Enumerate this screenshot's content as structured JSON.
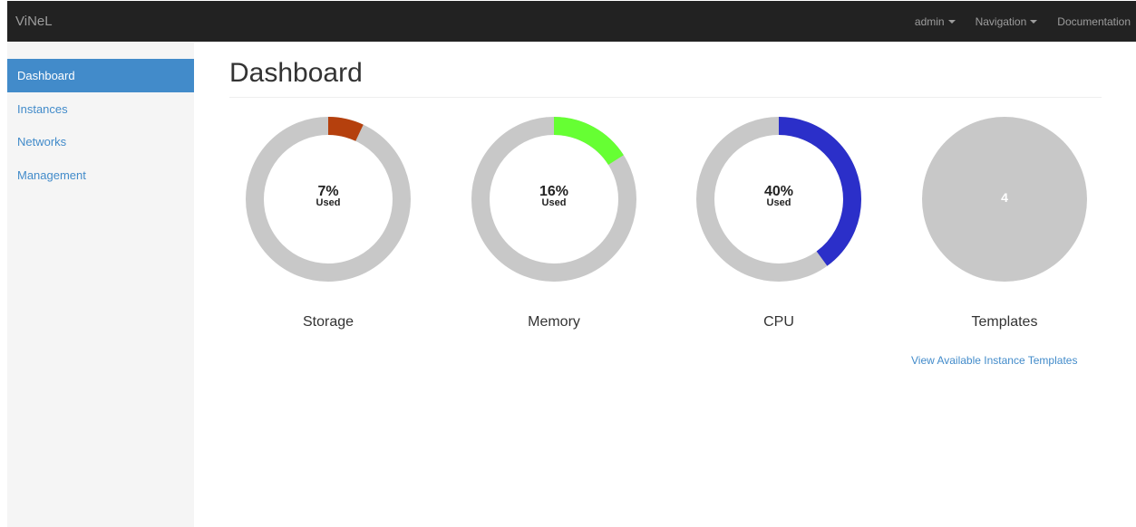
{
  "navbar": {
    "brand": "ViNeL",
    "user_menu": "admin",
    "navigation_menu": "Navigation",
    "documentation": "Documentation"
  },
  "sidebar": {
    "items": [
      {
        "label": "Dashboard",
        "active": true
      },
      {
        "label": "Instances",
        "active": false
      },
      {
        "label": "Networks",
        "active": false
      },
      {
        "label": "Management",
        "active": false
      }
    ]
  },
  "main": {
    "title": "Dashboard",
    "gauges": [
      {
        "label": "Storage",
        "percent": 7,
        "value_text": "7%",
        "sub_text": "Used",
        "color": "#b5400d"
      },
      {
        "label": "Memory",
        "percent": 16,
        "value_text": "16%",
        "sub_text": "Used",
        "color": "#66ff33"
      },
      {
        "label": "CPU",
        "percent": 40,
        "value_text": "40%",
        "sub_text": "Used",
        "color": "#2b2fc9"
      }
    ],
    "templates": {
      "label": "Templates",
      "count": "4",
      "link": "View Available Instance Templates"
    }
  },
  "colors": {
    "track": "#c8c8c8",
    "navbar": "#222222",
    "accent": "#428bca"
  }
}
